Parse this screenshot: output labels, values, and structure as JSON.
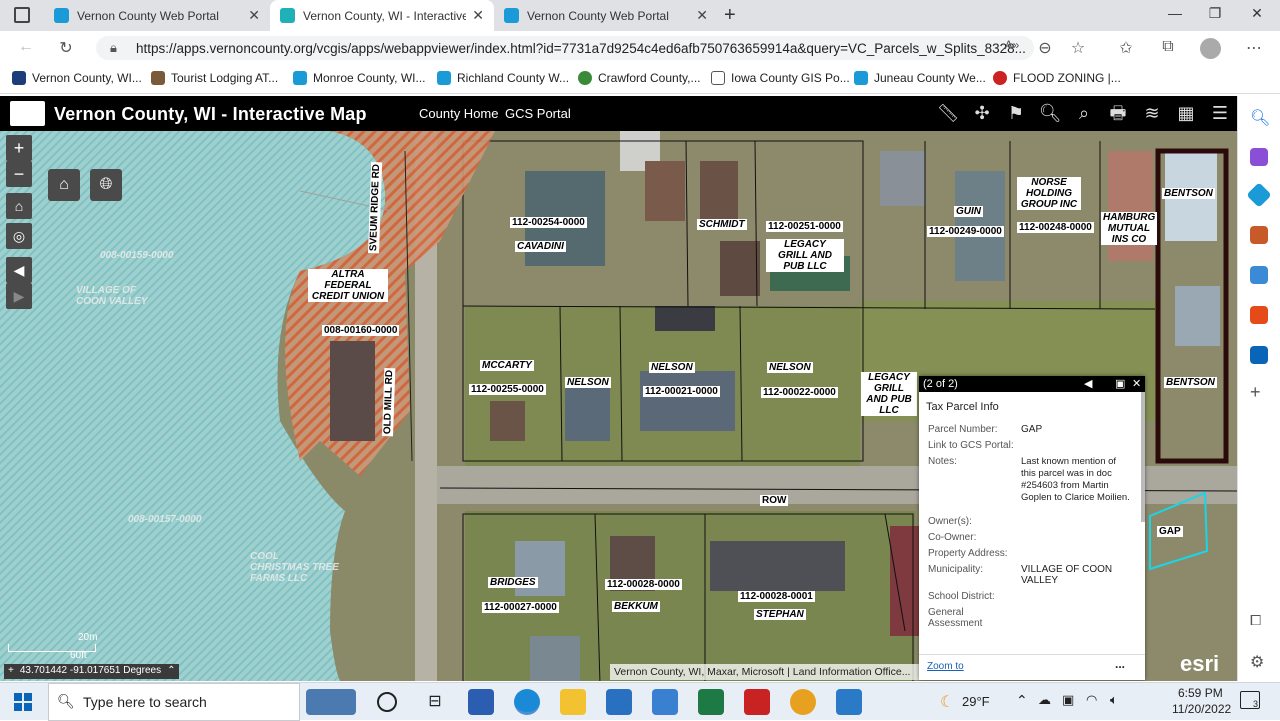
{
  "browser": {
    "tabs": [
      {
        "title": "Vernon County Web Portal",
        "active": false
      },
      {
        "title": "Vernon County, WI - Interactive M",
        "active": true
      },
      {
        "title": "Vernon County Web Portal",
        "active": false
      }
    ],
    "url": "https://apps.vernoncounty.org/vcgis/apps/webappviewer/index.html?id=7731a7d9254c4ed6afb750763659914a&query=VC_Parcels_w_Splits_8328...",
    "favorites": [
      "Vernon County, WI...",
      "Tourist Lodging AT...",
      "Monroe County, WI...",
      "Richland County W...",
      "Crawford County,...",
      "Iowa County GIS Po...",
      "Juneau County We...",
      "FLOOD ZONING |..."
    ]
  },
  "app": {
    "title": "Vernon County, WI - Interactive Map",
    "links": [
      "County Home",
      "GCS Portal"
    ]
  },
  "map": {
    "parcels": [
      {
        "owner": "CAVADINI",
        "number": "112-00254-0000"
      },
      {
        "owner": "SCHMIDT",
        "number": ""
      },
      {
        "owner": "LEGACY GRILL AND PUB LLC",
        "number": "112-00251-0000"
      },
      {
        "owner": "GUIN",
        "number": "112-00249-0000"
      },
      {
        "owner": "NORSE HOLDING GROUP INC",
        "number": "112-00248-0000"
      },
      {
        "owner": "HAMBURG MUTUAL INS CO",
        "number": ""
      },
      {
        "owner": "BENTSON",
        "number": ""
      },
      {
        "owner": "ALTRA FEDERAL CREDIT UNION",
        "number": "008-00160-0000"
      },
      {
        "owner": "MCCARTY",
        "number": "112-00255-0000"
      },
      {
        "owner": "NELSON",
        "number": "112-00021-0000"
      },
      {
        "owner": "NELSON",
        "number": "112-00022-0000"
      },
      {
        "owner": "LEGACY GRILL AND PUB LLC",
        "number": ""
      },
      {
        "owner": "BRIDGES",
        "number": "112-00027-0000"
      },
      {
        "owner": "BEKKUM",
        "number": "112-00028-0000"
      },
      {
        "owner": "STEPHAN",
        "number": "112-00028-0001"
      },
      {
        "owner": "GAP",
        "number": ""
      }
    ],
    "labels": {
      "nelson_mid": "NELSON",
      "bentson_right": "BENTSON",
      "row": "ROW",
      "sveum_ridge": "SVEUM RIDGE RD",
      "old_mill": "OLD MILL RD",
      "village_coon_valley": "VILLAGE OF COON VALLEY",
      "christmas": "COOL CHRISTMAS TREE FARMS LLC",
      "ghost_num1": "008-00159-0000",
      "ghost_num2": "008-00157-0000"
    },
    "scale": {
      "metric": "20m",
      "imperial": "60ft"
    },
    "coordinates": "43.701442 -91.017651 Degrees",
    "attribution": "Vernon County, WI, Maxar, Microsoft | Land Information Office...",
    "esri": "esri"
  },
  "popup": {
    "counter": "(2 of 2)",
    "title": "Tax Parcel Info",
    "fields": [
      {
        "key": "Parcel Number:",
        "value": "GAP"
      },
      {
        "key": "Link to GCS Portal:",
        "value": ""
      },
      {
        "key": "Notes:",
        "value": "Last known mention of this parcel was in doc #254603 from Martin Goplen to Clarice Moilien."
      },
      {
        "key": "Owner(s):",
        "value": ""
      },
      {
        "key": "Co-Owner:",
        "value": ""
      },
      {
        "key": "Property Address:",
        "value": ""
      },
      {
        "key": "Municipality:",
        "value": "VILLAGE OF COON VALLEY"
      },
      {
        "key": "School District:",
        "value": ""
      },
      {
        "key": "General Assessment",
        "value": ""
      }
    ],
    "zoom": "Zoom to",
    "more": "..."
  },
  "taskbar": {
    "search_placeholder": "Type here to search",
    "temperature": "29°F",
    "time": "6:59 PM",
    "date": "11/20/2022",
    "notifications": "3"
  },
  "colors": {
    "accent": "#1a73e8",
    "header": "#000000",
    "hatch": "#d9633a"
  }
}
